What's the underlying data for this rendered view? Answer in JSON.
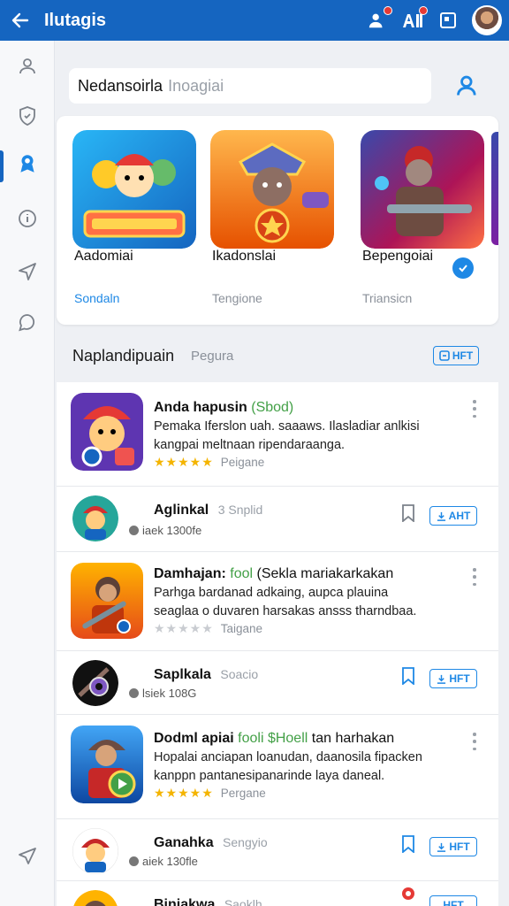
{
  "header": {
    "title": "Ilutagis"
  },
  "search": {
    "value": "Nedansoirla",
    "placeholder": "Inoagiai"
  },
  "featured": [
    {
      "name": "Aadomiai",
      "sub": "Sondaln"
    },
    {
      "name": "Ikadonslai",
      "sub": "Tengione"
    },
    {
      "name": "Bepengoiai",
      "sub": "Triansicn"
    }
  ],
  "section": {
    "title": "Naplandipuain",
    "subtitle": "Pegura",
    "button": "HFT"
  },
  "list": [
    {
      "name": "Anda hapusin",
      "tag": "(Sbod)",
      "desc1": "Pemaka Iferslon uah. saaaws. Ilasladiar anlkisi",
      "desc2": "kangpai meltnaan ripendaraanga.",
      "rating": 5,
      "rating_label": "Peigane"
    },
    {
      "name": "Aglinkal",
      "tag": "3 Snplid",
      "meta": "iaek 1300fe",
      "button": "AHT"
    },
    {
      "name": "Damhajan:",
      "tag": "fool",
      "name_rest": "(Sekla mariakarkakan",
      "desc1": "Parhga bardanad adkaing, aupca plauina",
      "desc2": "seaglaa o duvaren harsakas ansss tharndbaa.",
      "rating": 0,
      "rating_label": "Taigane"
    },
    {
      "name": "Saplkala",
      "tag": "Soacio",
      "meta": "lsiek 108G",
      "button": "HFT"
    },
    {
      "name": "Dodml apiai",
      "tag": "fooli $Hoell",
      "name_rest": "tan harhakan",
      "desc1": "Hopalai anciapan loanudan, daanosila fipacken",
      "desc2": "kanppn pantanesipanarinde laya daneal.",
      "rating": 5,
      "rating_label": "Pergane"
    },
    {
      "name": "Ganahka",
      "tag": "Sengyio",
      "meta": "aiek 130fle",
      "button": "HFT"
    },
    {
      "name": "Biniakwa",
      "tag": "Saoklh",
      "button": "HFT"
    }
  ],
  "colors": {
    "primary": "#1565c0",
    "accent": "#1e88e5",
    "star": "#f4b400",
    "tag_green": "#43a047"
  },
  "icons": [
    "back-arrow-icon",
    "user-add-icon",
    "ad-icon",
    "tablet-icon",
    "user-icon",
    "shield-icon",
    "badge-icon",
    "info-icon",
    "send-icon",
    "chat-icon",
    "bookmark-icon",
    "check-icon"
  ]
}
